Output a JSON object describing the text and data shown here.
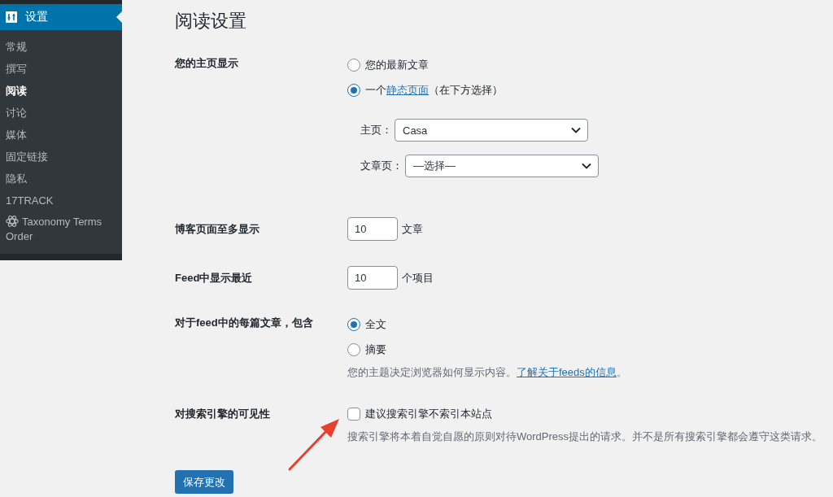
{
  "sidebar": {
    "header": {
      "title": "设置"
    },
    "items": [
      {
        "label": "常规",
        "selected": false,
        "kind": "plain"
      },
      {
        "label": "撰写",
        "selected": false,
        "kind": "plain"
      },
      {
        "label": "阅读",
        "selected": true,
        "kind": "plain"
      },
      {
        "label": "讨论",
        "selected": false,
        "kind": "plain"
      },
      {
        "label": "媒体",
        "selected": false,
        "kind": "plain"
      },
      {
        "label": "固定链接",
        "selected": false,
        "kind": "plain"
      },
      {
        "label": "隐私",
        "selected": false,
        "kind": "plain"
      },
      {
        "label": "17TRACK",
        "selected": false,
        "kind": "plain"
      },
      {
        "label": "Taxonomy Terms Order",
        "selected": false,
        "kind": "plugin"
      }
    ]
  },
  "page": {
    "title": "阅读设置"
  },
  "settings": [
    {
      "kind": "radio",
      "label": "您的主页显示",
      "options": [
        {
          "text": "您的最新文章",
          "selected": false
        },
        {
          "text": "一个",
          "link": "静态页面",
          "text_after": "（在下方选择）",
          "selected": true
        }
      ],
      "selects": [
        {
          "label": "主页：",
          "value": "Casa"
        },
        {
          "label": "文章页：",
          "value": "—选择—"
        }
      ]
    },
    {
      "kind": "number",
      "label": "博客页面至多显示",
      "value": "10",
      "unit": "文章"
    },
    {
      "kind": "number",
      "label": "Feed中显示最近",
      "value": "10",
      "unit": "个项目"
    },
    {
      "kind": "radio",
      "label": "对于feed中的每篇文章，包含",
      "options": [
        {
          "text": "全文",
          "selected": true
        },
        {
          "text": "摘要",
          "selected": false
        }
      ],
      "description": {
        "text": "您的主题决定浏览器如何显示内容。",
        "link": "了解关于feeds的信息",
        "text_after": "。"
      }
    },
    {
      "kind": "checkbox",
      "label": "对搜索引擎的可见性",
      "option": {
        "text": "建议搜索引擎不索引本站点",
        "checked": false
      },
      "description": {
        "text": "搜索引擎将本着自觉自愿的原则对待WordPress提出的请求。并不是所有搜索引擎都会遵守这类请求。"
      }
    }
  ],
  "save_button": "保存更改",
  "annotations": [
    {
      "kind": "arrow"
    }
  ]
}
